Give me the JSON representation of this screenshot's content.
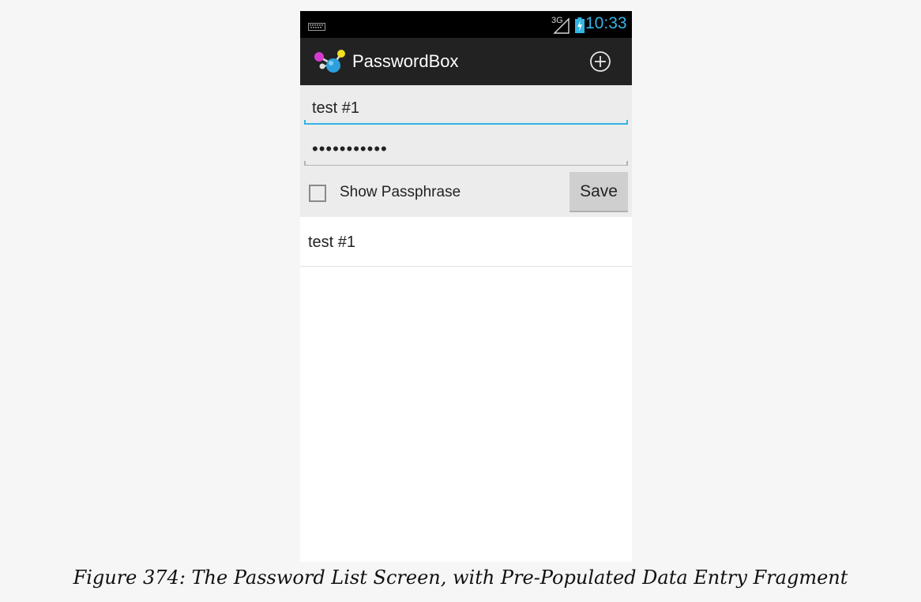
{
  "status_bar": {
    "network": "3G",
    "time": "10:33"
  },
  "action_bar": {
    "title": "PasswordBox",
    "app_icon": "molecule-app-icon",
    "add_icon": "add-circle-icon"
  },
  "entry": {
    "title_value": "test #1",
    "passphrase_value": "•••••••••••",
    "show_passphrase_label": "Show Passphrase",
    "show_passphrase_checked": false,
    "save_label": "Save"
  },
  "list": {
    "items": [
      {
        "label": "test #1"
      }
    ]
  },
  "caption": "Figure 374: The Password List Screen, with Pre-Populated Data Entry Fragment",
  "colors": {
    "accent": "#33b5e5",
    "action_bar": "#222222",
    "status_bar": "#000000"
  }
}
